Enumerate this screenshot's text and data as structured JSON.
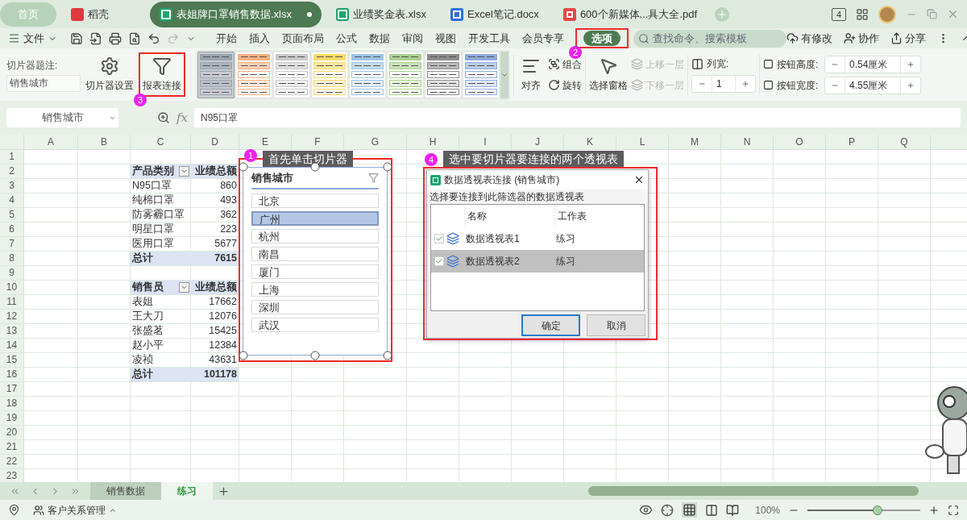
{
  "title_bar": {
    "tabs": [
      {
        "label": "首页",
        "kind": "home",
        "selected": false,
        "unsaved": false
      },
      {
        "label": "稻壳",
        "kind": "app",
        "selected": false,
        "unsaved": false
      },
      {
        "label": "表姐牌口罩销售数据.xlsx",
        "kind": "sheet",
        "selected": true,
        "unsaved": true
      },
      {
        "label": "业绩奖金表.xlsx",
        "kind": "sheet",
        "selected": false,
        "unsaved": false
      },
      {
        "label": "Excel笔记.docx",
        "kind": "doc",
        "selected": false,
        "unsaved": false
      },
      {
        "label": "600个新媒体...具大全.pdf",
        "kind": "pdf",
        "selected": false,
        "unsaved": false
      }
    ],
    "device_badge": "4"
  },
  "menu": {
    "file": "文件",
    "items": [
      {
        "label": "开始",
        "selected": false
      },
      {
        "label": "插入",
        "selected": false
      },
      {
        "label": "页面布局",
        "selected": false
      },
      {
        "label": "公式",
        "selected": false
      },
      {
        "label": "数据",
        "selected": false
      },
      {
        "label": "审阅",
        "selected": false
      },
      {
        "label": "视图",
        "selected": false
      },
      {
        "label": "开发工具",
        "selected": false
      },
      {
        "label": "会员专享",
        "selected": false
      },
      {
        "label": "选项",
        "selected": true
      }
    ],
    "search": {
      "placeholder": "查找命令、搜索模板"
    },
    "actions": [
      "有修改",
      "协作",
      "分享"
    ]
  },
  "ribbon": {
    "caption_label": "切片器题注:",
    "caption_value": "销售城市",
    "settings_button": "切片器设置",
    "connect_button": "报表连接",
    "styles": [
      {
        "color": "#9aa3ad",
        "selected": true
      },
      {
        "color": "#f4b183",
        "selected": false
      },
      {
        "color": "#c9c9c9",
        "selected": false
      },
      {
        "color": "#ffd966",
        "selected": false
      },
      {
        "color": "#9dc3e6",
        "selected": false
      },
      {
        "color": "#a9d18e",
        "selected": false
      },
      {
        "color": "#8c8c8c",
        "selected": false
      },
      {
        "color": "#8faadc",
        "selected": false
      }
    ],
    "align": "对齐",
    "group": "组合",
    "rotate": "旋转",
    "selection_pane": "选择窗格",
    "bring_forward": {
      "label": "上移一层",
      "disabled": true
    },
    "send_backward": {
      "label": "下移一层",
      "disabled": true
    },
    "column_width": {
      "label": "列宽:",
      "value": "1"
    },
    "button_height": {
      "label": "按钮高度:",
      "value": "0.54厘米"
    },
    "button_width": {
      "label": "按钮宽度:",
      "value": "4.55厘米"
    }
  },
  "formula_bar": {
    "name_box": "销售城市",
    "fx_label": "fx",
    "value": "N95口罩"
  },
  "sheet": {
    "columns": [
      "A",
      "B",
      "C",
      "D",
      "E",
      "F",
      "G",
      "H",
      "I",
      "J",
      "K",
      "L",
      "M",
      "N",
      "O",
      "P",
      "Q"
    ],
    "rows": [
      "1",
      "2",
      "3",
      "4",
      "5",
      "6",
      "7",
      "8",
      "9",
      "10",
      "11",
      "12",
      "13",
      "14",
      "15",
      "16",
      "17",
      "18",
      "19",
      "20",
      "21",
      "22",
      "23"
    ],
    "pivots": [
      {
        "header": [
          "产品类别",
          "业绩总额"
        ],
        "rows": [
          [
            "N95口罩",
            "860"
          ],
          [
            "纯棉口罩",
            "493"
          ],
          [
            "防雾霾口罩",
            "362"
          ],
          [
            "明星口罩",
            "223"
          ],
          [
            "医用口罩",
            "5677"
          ]
        ],
        "total": [
          "总计",
          "7615"
        ]
      },
      {
        "header": [
          "销售员",
          "业绩总额"
        ],
        "rows": [
          [
            "表姐",
            "17662"
          ],
          [
            "王大刀",
            "12076"
          ],
          [
            "张盛茗",
            "15425"
          ],
          [
            "赵小平",
            "12384"
          ],
          [
            "凌祯",
            "43631"
          ]
        ],
        "total": [
          "总计",
          "101178"
        ]
      }
    ]
  },
  "slicer": {
    "title": "销售城市",
    "items": [
      {
        "label": "北京",
        "selected": false
      },
      {
        "label": "广州",
        "selected": true
      },
      {
        "label": "杭州",
        "selected": false
      },
      {
        "label": "南昌",
        "selected": false
      },
      {
        "label": "厦门",
        "selected": false
      },
      {
        "label": "上海",
        "selected": false
      },
      {
        "label": "深圳",
        "selected": false
      },
      {
        "label": "武汉",
        "selected": false
      }
    ]
  },
  "dialog": {
    "title": "数据透视表连接 (销售城市)",
    "instruction": "选择要连接到此筛选器的数据透视表",
    "columns": [
      "名称",
      "工作表"
    ],
    "rows": [
      {
        "name": "数据透视表1",
        "sheet": "练习",
        "checked": true,
        "selected": false
      },
      {
        "name": "数据透视表2",
        "sheet": "练习",
        "checked": true,
        "selected": true
      }
    ],
    "buttons": [
      "确定",
      "取消"
    ]
  },
  "annotations": [
    {
      "number": "1",
      "text": "首先单击切片器"
    },
    {
      "number": "2"
    },
    {
      "number": "3"
    },
    {
      "number": "4",
      "text": "选中要切片器要连接的两个透视表"
    }
  ],
  "sheet_tabs": [
    {
      "label": "销售数据",
      "selected": false
    },
    {
      "label": "练习",
      "selected": true
    }
  ],
  "status_bar": {
    "app": "客户关系管理",
    "zoom": "100%",
    "zoom_slider": {
      "level": 0.62
    }
  }
}
